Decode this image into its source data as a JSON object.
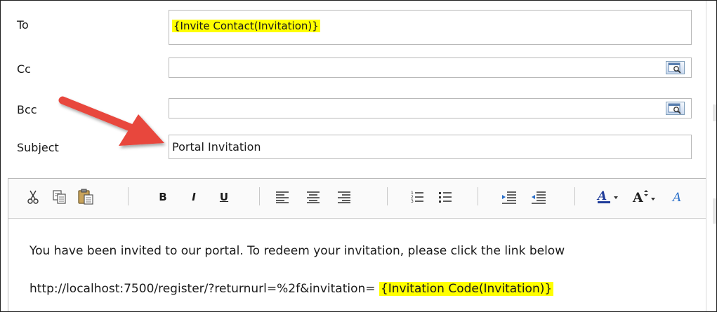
{
  "form": {
    "to": {
      "label": "To",
      "value": "{Invite Contact(Invitation)}"
    },
    "cc": {
      "label": "Cc",
      "value": ""
    },
    "bcc": {
      "label": "Bcc",
      "value": ""
    },
    "subject": {
      "label": "Subject",
      "value": "Portal Invitation"
    }
  },
  "lookup_icon": "address-book-lookup-icon",
  "toolbar": {
    "bold": "B",
    "italic": "I",
    "underline": "U",
    "icons": [
      "cut-icon",
      "copy-icon",
      "paste-icon",
      "align-left-icon",
      "align-center-icon",
      "align-right-icon",
      "numbered-list-icon",
      "bulleted-list-icon",
      "decrease-indent-icon",
      "increase-indent-icon",
      "font-color-icon",
      "font-size-icon"
    ]
  },
  "body": {
    "line1": "You have been invited to our portal. To redeem your invitation, please click the link below",
    "link_prefix": "http://localhost:7500/register/?returnurl=%2f&invitation= ",
    "link_token": "{Invitation Code(Invitation)}"
  },
  "colors": {
    "highlight": "#ffff00",
    "arrow": "#e8473e"
  }
}
